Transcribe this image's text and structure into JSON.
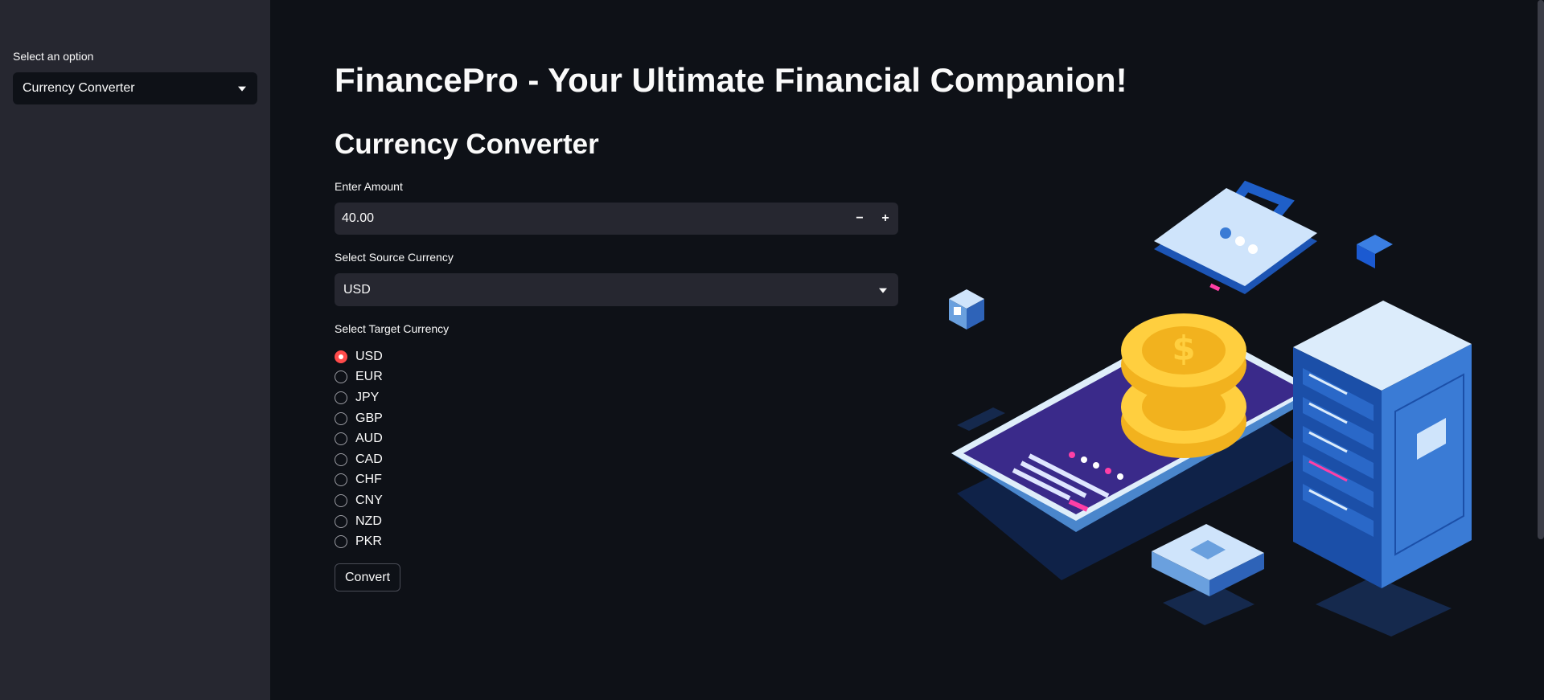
{
  "sidebar": {
    "label": "Select an option",
    "selected": "Currency Converter"
  },
  "main": {
    "title": "FinancePro - Your Ultimate Financial Companion!",
    "subtitle": "Currency Converter",
    "amount": {
      "label": "Enter Amount",
      "value": "40.00",
      "decrement": "−",
      "increment": "+"
    },
    "source": {
      "label": "Select Source Currency",
      "selected": "USD"
    },
    "target": {
      "label": "Select Target Currency",
      "options": [
        "USD",
        "EUR",
        "JPY",
        "GBP",
        "AUD",
        "CAD",
        "CHF",
        "CNY",
        "NZD",
        "PKR"
      ],
      "selected": "USD"
    },
    "convert_label": "Convert"
  },
  "colors": {
    "background": "#0e1117",
    "sidebar": "#262730",
    "input": "#262730",
    "accent": "#ff4b4b"
  },
  "illustration": {
    "icon": "finance-isometric-illustration"
  }
}
